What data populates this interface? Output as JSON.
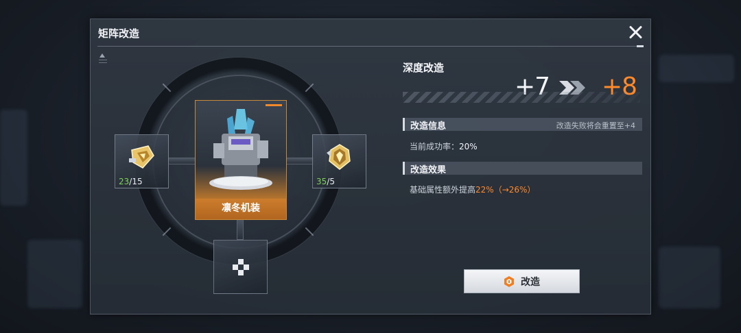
{
  "dialog": {
    "title": "矩阵改造"
  },
  "materials": [
    {
      "have": "23",
      "need": "/15",
      "icon": "gold-chip-icon"
    },
    {
      "have": "35",
      "need": "/5",
      "icon": "gold-crest-icon"
    }
  ],
  "target": {
    "name": "凛冬机装",
    "image": "winter-mech-icon"
  },
  "slot": {
    "icon": "dpad-icon"
  },
  "upgrade": {
    "section_title": "深度改造",
    "from_level": "+7",
    "to_level": "+8",
    "info_header": "改造信息",
    "info_note": "改造失败将会重置至+4",
    "success_label": "当前成功率：",
    "success_value": "20%",
    "effect_header": "改造效果",
    "effect_label": "基础属性额外提高",
    "effect_value": "22%",
    "effect_next": "（→26%）",
    "button_label": "改造",
    "button_icon": "hexagon-wrench-icon"
  },
  "colors": {
    "accent": "#ff8a2b",
    "have_ok": "#7ed35a"
  }
}
